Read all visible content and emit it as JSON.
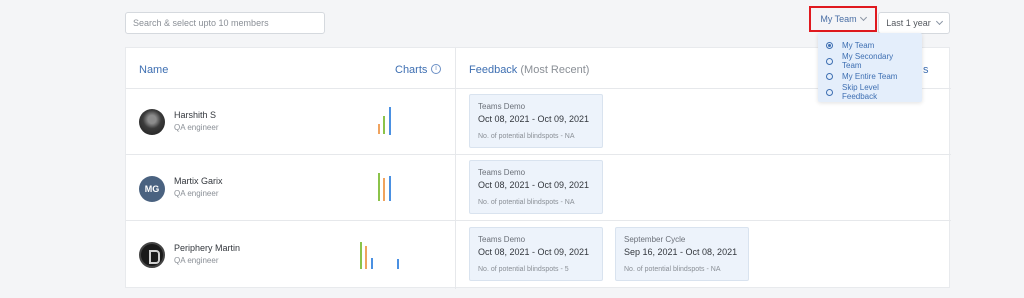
{
  "search": {
    "placeholder": "Search & select upto 10 members"
  },
  "filters": {
    "team": "My Team",
    "period": "Last 1 year"
  },
  "team_dropdown": {
    "options": [
      {
        "label": "My Team",
        "selected": true
      },
      {
        "label": "My Secondary Team",
        "selected": false
      },
      {
        "label": "My Entire Team",
        "selected": false
      },
      {
        "label": "Skip Level Feedback",
        "selected": false
      }
    ]
  },
  "table": {
    "headers": {
      "name": "Name",
      "charts": "Charts",
      "info_glyph": "i",
      "feedback": "Feedback",
      "feedback_note": "(Most Recent)",
      "clipped": "s"
    },
    "rows": [
      {
        "name": "Harshith S",
        "role": "QA engineer",
        "avatar_initials": "",
        "feedback": [
          {
            "cycle": "Teams Demo",
            "range": "Oct 08, 2021 - Oct 09, 2021",
            "note": "No. of potential blindspots - NA"
          }
        ]
      },
      {
        "name": "Martix Garix",
        "role": "QA engineer",
        "avatar_initials": "MG",
        "feedback": [
          {
            "cycle": "Teams Demo",
            "range": "Oct 08, 2021 - Oct 09, 2021",
            "note": "No. of potential blindspots - NA"
          }
        ]
      },
      {
        "name": "Periphery Martin",
        "role": "QA engineer",
        "avatar_initials": "",
        "feedback": [
          {
            "cycle": "Teams Demo",
            "range": "Oct 08, 2021 - Oct 09, 2021",
            "note": "No. of potential blindspots - 5"
          },
          {
            "cycle": "September Cycle",
            "range": "Sep 16, 2021 - Oct 08, 2021",
            "note": "No. of potential blindspots - NA"
          }
        ]
      }
    ]
  },
  "colors": {
    "accent": "#3e6fb2",
    "highlight_border": "#e0191f",
    "bar_green": "#8bc34a",
    "bar_orange": "#f0a35e",
    "bar_blue": "#4a90e2"
  }
}
